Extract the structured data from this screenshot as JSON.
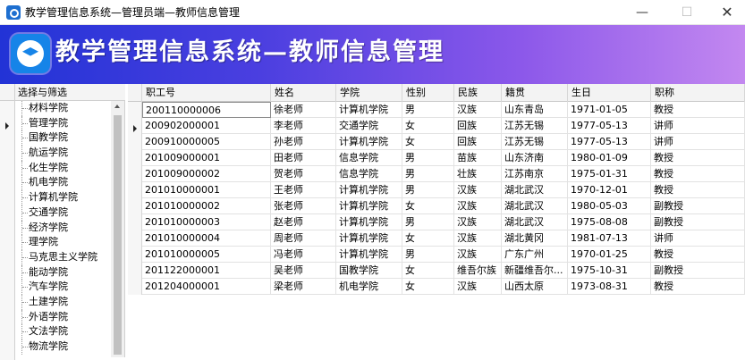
{
  "window": {
    "title": "教学管理信息系统—管理员端—教师信息管理",
    "minimize_label": "—",
    "maximize_label": "☐",
    "close_label": "✕"
  },
  "banner": {
    "title": "教学管理信息系统—教师信息管理",
    "logo_icon": "graduation-cap-icon",
    "gradient_start": "#2233d6",
    "gradient_end": "#c388f0"
  },
  "filter_tree": {
    "header": "选择与筛选",
    "items": [
      "材料学院",
      "管理学院",
      "国教学院",
      "航运学院",
      "化生学院",
      "机电学院",
      "计算机学院",
      "交通学院",
      "经济学院",
      "理学院",
      "马克思主义学院",
      "能动学院",
      "汽车学院",
      "土建学院",
      "外语学院",
      "文法学院",
      "物流学院"
    ]
  },
  "grid": {
    "columns": [
      "职工号",
      "姓名",
      "学院",
      "性别",
      "民族",
      "籍贯",
      "生日",
      "职称"
    ],
    "rows": [
      [
        "200110000006",
        "徐老师",
        "计算机学院",
        "男",
        "汉族",
        "山东青岛",
        "1971-01-05",
        "教授"
      ],
      [
        "200902000001",
        "李老师",
        "交通学院",
        "女",
        "回族",
        "江苏无锡",
        "1977-05-13",
        "讲师"
      ],
      [
        "200910000005",
        "孙老师",
        "计算机学院",
        "女",
        "回族",
        "江苏无锡",
        "1977-05-13",
        "讲师"
      ],
      [
        "201009000001",
        "田老师",
        "信息学院",
        "男",
        "苗族",
        "山东济南",
        "1980-01-09",
        "教授"
      ],
      [
        "201009000002",
        "贺老师",
        "信息学院",
        "男",
        "壮族",
        "江苏南京",
        "1975-01-31",
        "教授"
      ],
      [
        "201010000001",
        "王老师",
        "计算机学院",
        "男",
        "汉族",
        "湖北武汉",
        "1970-12-01",
        "教授"
      ],
      [
        "201010000002",
        "张老师",
        "计算机学院",
        "女",
        "汉族",
        "湖北武汉",
        "1980-05-03",
        "副教授"
      ],
      [
        "201010000003",
        "赵老师",
        "计算机学院",
        "男",
        "汉族",
        "湖北武汉",
        "1975-08-08",
        "副教授"
      ],
      [
        "201010000004",
        "周老师",
        "计算机学院",
        "女",
        "汉族",
        "湖北黄冈",
        "1981-07-13",
        "讲师"
      ],
      [
        "201010000005",
        "冯老师",
        "计算机学院",
        "男",
        "汉族",
        "广东广州",
        "1970-01-25",
        "教授"
      ],
      [
        "201122000001",
        "吴老师",
        "国教学院",
        "女",
        "维吾尔族",
        "新疆维吾尔...",
        "1975-10-31",
        "副教授"
      ],
      [
        "201204000001",
        "梁老师",
        "机电学院",
        "女",
        "汉族",
        "山西太原",
        "1973-08-31",
        "教授"
      ]
    ]
  }
}
